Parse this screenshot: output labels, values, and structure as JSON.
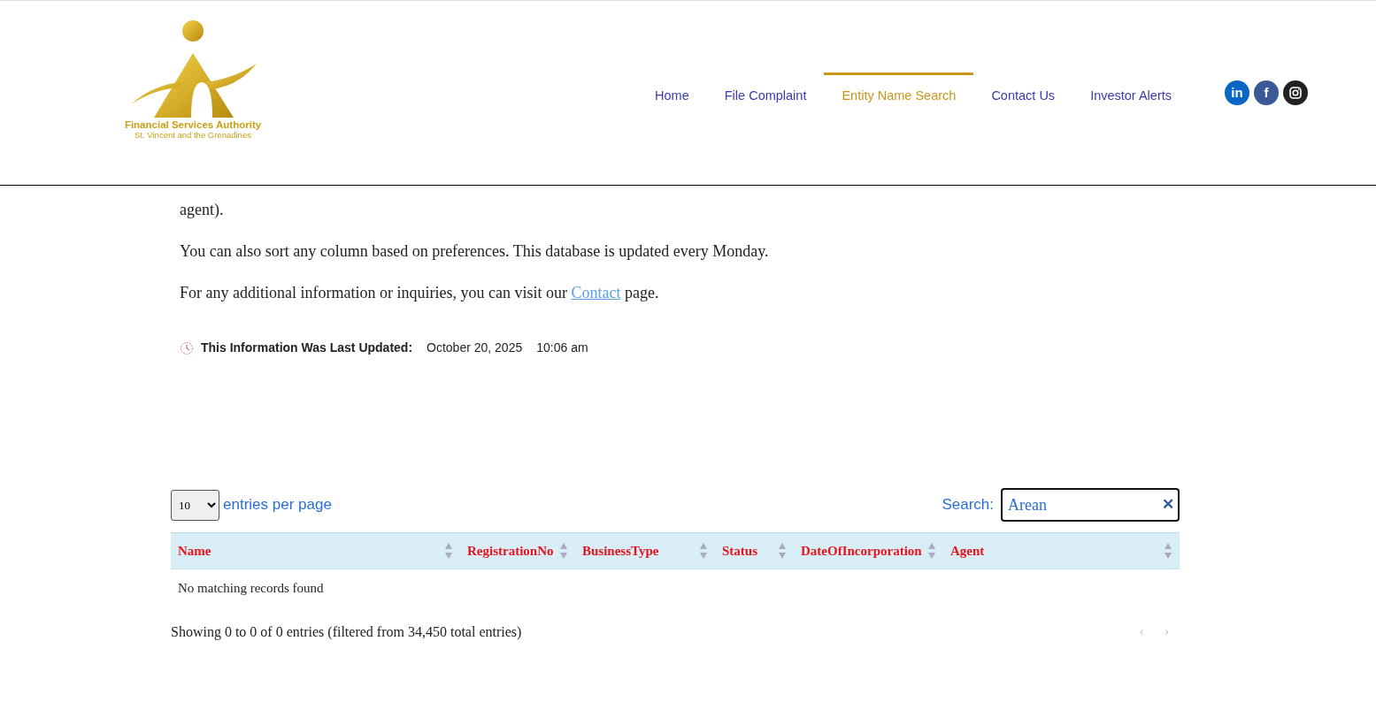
{
  "logo": {
    "title": "Financial Services Authority",
    "subtitle": "St. Vincent and the Grenadines"
  },
  "nav": [
    {
      "label": "Home",
      "selected": false
    },
    {
      "label": "File Complaint",
      "selected": false
    },
    {
      "label": "Entity Name Search",
      "selected": true
    },
    {
      "label": "Contact Us",
      "selected": false
    },
    {
      "label": "Investor Alerts",
      "selected": false
    }
  ],
  "social": [
    {
      "kind": "linkedin",
      "glyph": "in",
      "color": "#0a66c2"
    },
    {
      "kind": "facebook",
      "glyph": "f",
      "color": "#3b5998"
    },
    {
      "kind": "instagram",
      "color": "#222222"
    }
  ],
  "intro": [
    "agent).",
    "You can also sort any column based on preferences. This database is updated every Monday."
  ],
  "contact_line": {
    "before": "For any additional information or inquiries, you can visit our",
    "link": "Contact",
    "after": "page."
  },
  "updated": {
    "label": "This Information Was Last Updated:",
    "date": "October 20, 2025",
    "time": "10:06 am"
  },
  "table": {
    "page_size": "10",
    "page_size_label": "entries per page",
    "search_label": "Search:",
    "search_value": "Arean",
    "clear": "✕",
    "columns": [
      "Name",
      "RegistrationNo",
      "BusinessType",
      "Status",
      "DateOfIncorporation",
      "Agent"
    ],
    "empty": "No matching records found",
    "info": "Showing 0 to 0 of 0 entries (filtered from 34,450 total entries)",
    "pager": [
      {
        "glyph": "‹",
        "disabled": true
      },
      {
        "glyph": "›",
        "disabled": true
      }
    ]
  }
}
